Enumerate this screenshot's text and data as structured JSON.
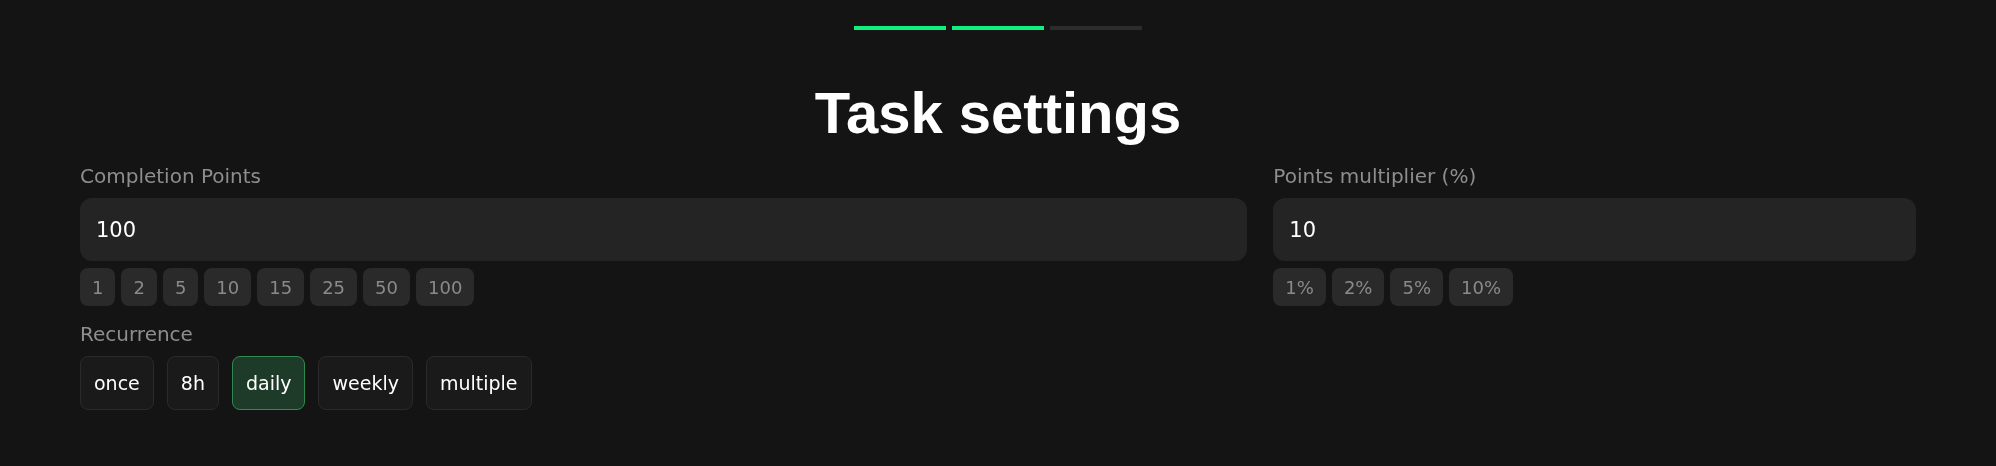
{
  "progress": [
    {
      "done": true
    },
    {
      "done": true
    },
    {
      "done": false
    }
  ],
  "title": "Task settings",
  "fields": [
    {
      "label": "Completion Points",
      "value": "100",
      "presets": [
        "1",
        "2",
        "5",
        "10",
        "15",
        "25",
        "50",
        "100"
      ]
    },
    {
      "label": "Points multiplier (%)",
      "value": "10",
      "presets": [
        "1%",
        "2%",
        "5%",
        "10%"
      ]
    }
  ],
  "recurrence": {
    "label": "Recurrence",
    "options": [
      {
        "label": "once",
        "selected": false
      },
      {
        "label": "8h",
        "selected": false
      },
      {
        "label": "daily",
        "selected": true
      },
      {
        "label": "weekly",
        "selected": false
      },
      {
        "label": "multiple",
        "selected": false
      }
    ]
  }
}
